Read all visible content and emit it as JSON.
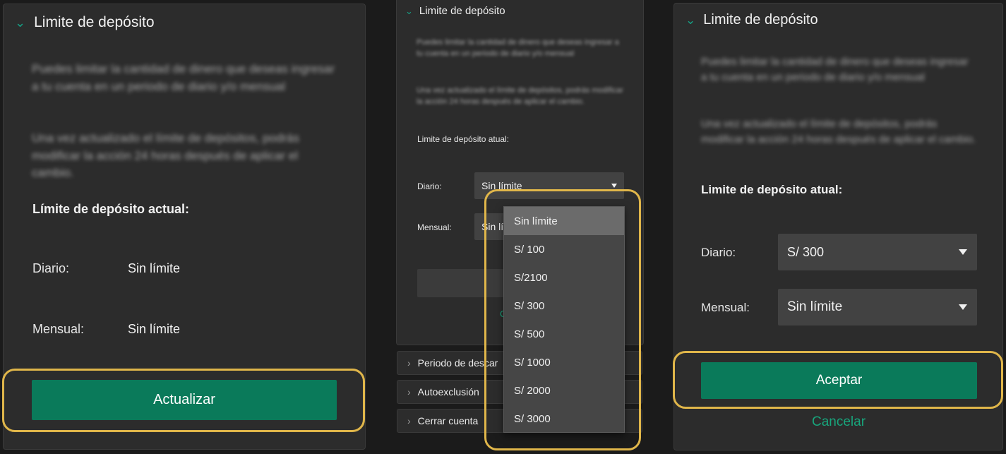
{
  "left": {
    "title": "Limite de depósito",
    "blur_text_1": "Puedes limitar la cantidad de dinero que deseas ingresar a tu cuenta en un periodo de diario y/o mensual",
    "blur_text_2": "Una vez actualizado el límite de depósitos, podrás modificar la acción 24 horas después de aplicar el cambio.",
    "current_label": "Límite de depósito actual:",
    "daily_label": "Diario:",
    "daily_value": "Sin límite",
    "monthly_label": "Mensual:",
    "monthly_value": "Sin límite",
    "update_button": "Actualizar"
  },
  "middle": {
    "title": "Limite de depósito",
    "blur_text_1": "Puedes limitar la cantidad de dinero que deseas ingresar a tu cuenta en un periodo de diario y/o mensual",
    "blur_text_2": "Una vez actualizado el límite de depósitos, podrás modificar la acción 24 horas después de aplicar el cambio.",
    "current_label": "Limite de depósito atual:",
    "daily_label": "Diario:",
    "daily_value": "Sin límite",
    "monthly_label": "Mensual:",
    "monthly_value_partial": "Sin lí",
    "cancel_partial": "C",
    "dropdown_options": [
      "Sin límite",
      "S/ 100",
      "S/2100",
      "S/ 300",
      "S/ 500",
      "S/ 1000",
      "S/ 2000",
      "S/ 3000"
    ],
    "dropdown_selected_index": 0,
    "accordions": [
      "Periodo de descar",
      "Autoexclusión",
      "Cerrar cuenta"
    ]
  },
  "right": {
    "title": "Limite de depósito",
    "blur_text_1": "Puedes limitar la cantidad de dinero que deseas ingresar a tu cuenta en un periodo de diario y/o mensual",
    "blur_text_2": "Una vez actualizado el límite de depósitos, podrás modificar la acción 24 horas después de aplicar el cambio.",
    "current_label": "Limite de depósito atual:",
    "daily_label": "Diario:",
    "daily_value": "S/ 300",
    "monthly_label": "Mensual:",
    "monthly_value": "Sin límite",
    "accept_button": "Aceptar",
    "cancel_link": "Cancelar"
  },
  "colors": {
    "accent_green": "#0a7a5a",
    "link_green": "#18a57c",
    "highlight": "#e0b64a",
    "panel": "#2c2c2c"
  }
}
